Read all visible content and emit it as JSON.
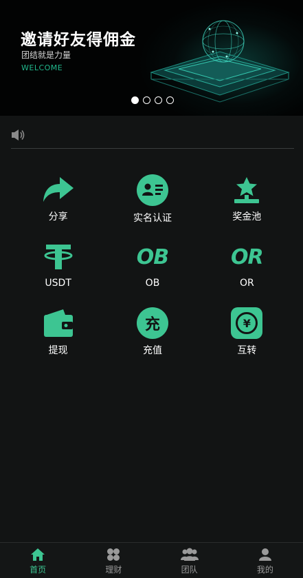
{
  "banner": {
    "title": "邀请好友得佣金",
    "subtitle": "团结就是力量",
    "welcome": "WELCOME",
    "slides": [
      true,
      false,
      false,
      false
    ]
  },
  "notice": {
    "text": ""
  },
  "grid": [
    {
      "label": "分享",
      "icon": "share-icon"
    },
    {
      "label": "实名认证",
      "icon": "id-card-icon"
    },
    {
      "label": "奖金池",
      "icon": "star-podium-icon"
    },
    {
      "label": "USDT",
      "icon": "tether-icon"
    },
    {
      "label": "OB",
      "icon": "ob-icon",
      "glyph": "OB"
    },
    {
      "label": "OR",
      "icon": "or-icon",
      "glyph": "OR"
    },
    {
      "label": "提现",
      "icon": "wallet-icon"
    },
    {
      "label": "充值",
      "icon": "recharge-icon",
      "glyph": "充"
    },
    {
      "label": "互转",
      "icon": "yen-transfer-icon",
      "glyph": "¥"
    }
  ],
  "tabbar": [
    {
      "label": "首页",
      "icon": "home-icon",
      "active": true
    },
    {
      "label": "理财",
      "icon": "grid-icon",
      "active": false
    },
    {
      "label": "团队",
      "icon": "team-icon",
      "active": false
    },
    {
      "label": "我的",
      "icon": "user-icon",
      "active": false
    }
  ],
  "colors": {
    "accent": "#3dc592",
    "background": "#121414",
    "welcome": "#21b98d"
  }
}
